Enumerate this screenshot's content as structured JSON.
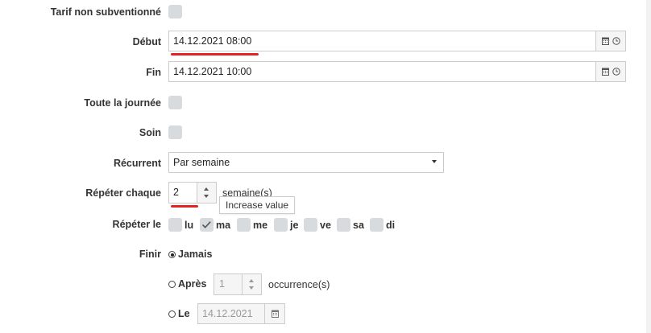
{
  "form": {
    "tarif_label": "Tarif non subventionné",
    "debut_label": "Début",
    "debut_value": "14.12.2021 08:00",
    "fin_label": "Fin",
    "fin_value": "14.12.2021 10:00",
    "journee_label": "Toute la journée",
    "soin_label": "Soin",
    "recurrent_label": "Récurrent",
    "recurrent_value": "Par semaine",
    "repeter_chaque_label": "Répéter chaque",
    "repeter_chaque_value": "2",
    "repeter_chaque_unit": "semaine(s)",
    "tooltip": "Increase value",
    "repeter_le_label": "Répéter le",
    "days": [
      {
        "label": "lu",
        "checked": false
      },
      {
        "label": "ma",
        "checked": true
      },
      {
        "label": "me",
        "checked": false
      },
      {
        "label": "je",
        "checked": false
      },
      {
        "label": "ve",
        "checked": false
      },
      {
        "label": "sa",
        "checked": false
      },
      {
        "label": "di",
        "checked": false
      }
    ],
    "finir_label": "Finir",
    "finir_jamais": "Jamais",
    "finir_apres": "Après",
    "apres_value": "1",
    "apres_unit": "occurrence(s)",
    "finir_le": "Le",
    "le_value": "14.12.2021"
  },
  "colors": {
    "highlight": "#e32222",
    "checkbox": "#d8dbde"
  },
  "icons": {
    "calendar": "calendar-icon",
    "clock": "clock-icon"
  }
}
